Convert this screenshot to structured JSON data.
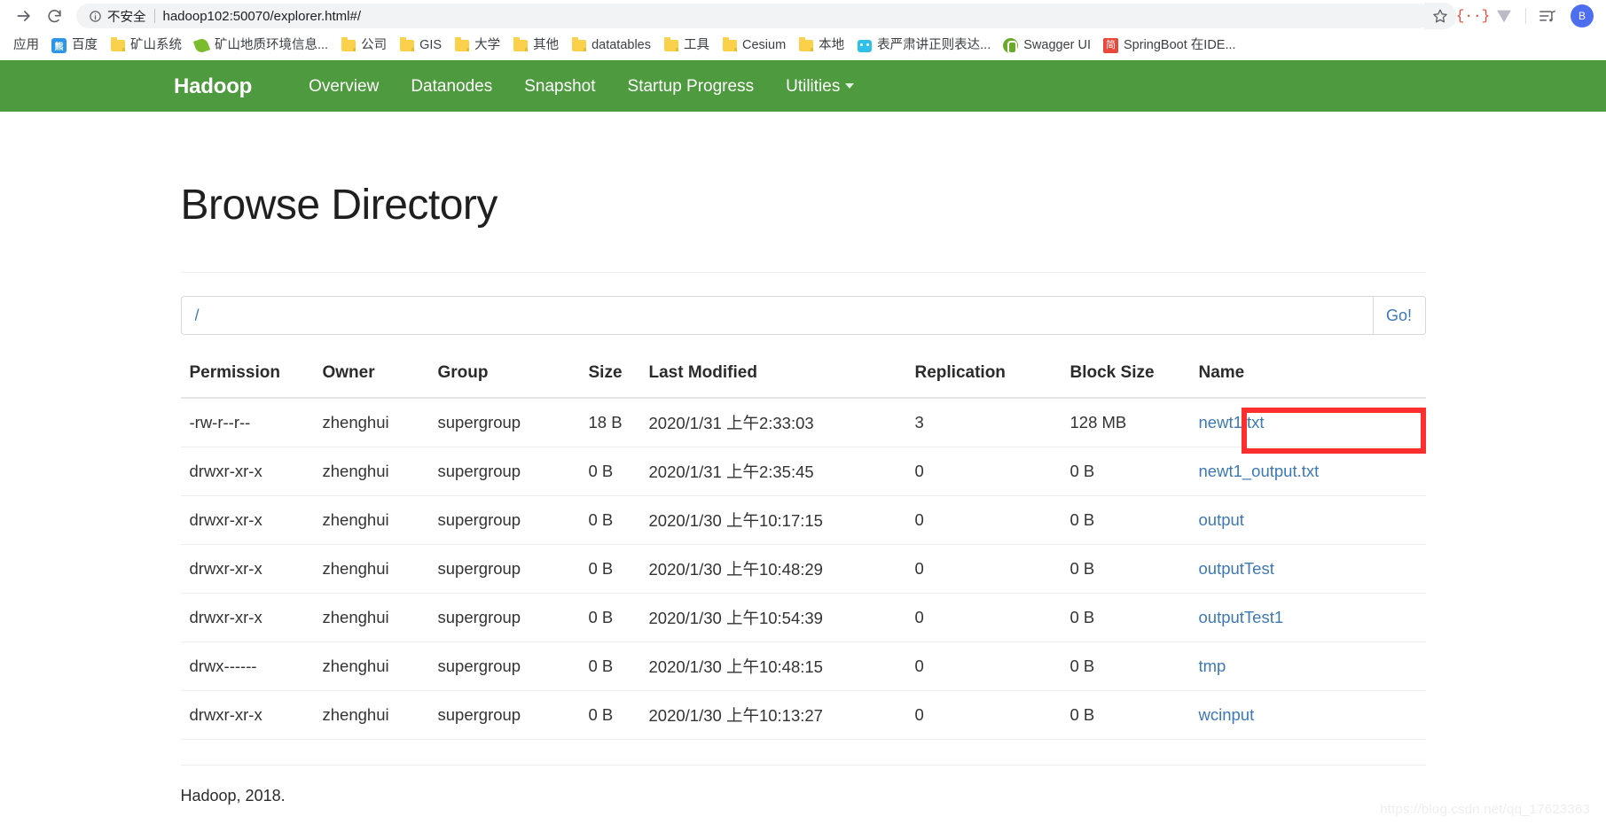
{
  "browser": {
    "back_icon": "back-arrow-icon",
    "reload_icon": "reload-icon",
    "info_icon": "info-circle-icon",
    "security_label": "不安全",
    "url": "hadoop102:50070/explorer.html#/",
    "star_icon": "star-icon",
    "extensions": [
      {
        "name": "json-formatter-icon",
        "glyph": "{ }"
      },
      {
        "name": "vue-devtools-icon",
        "glyph": "V"
      },
      {
        "name": "reading-list-icon",
        "glyph": "≡♪"
      }
    ],
    "avatar_label": "B",
    "bookmarks": [
      {
        "label": "应用",
        "icon": "apps-icon"
      },
      {
        "label": "百度",
        "icon": "baidu-icon"
      },
      {
        "label": "矿山系统",
        "icon": "folder-icon"
      },
      {
        "label": "矿山地质环境信息...",
        "icon": "leaf-icon"
      },
      {
        "label": "公司",
        "icon": "folder-icon"
      },
      {
        "label": "GIS",
        "icon": "folder-icon"
      },
      {
        "label": "大学",
        "icon": "folder-icon"
      },
      {
        "label": "其他",
        "icon": "folder-icon"
      },
      {
        "label": "datatables",
        "icon": "folder-icon"
      },
      {
        "label": "工具",
        "icon": "folder-icon"
      },
      {
        "label": "Cesium",
        "icon": "folder-icon"
      },
      {
        "label": "本地",
        "icon": "folder-icon"
      },
      {
        "label": "表严肃讲正则表达...",
        "icon": "tv-icon"
      },
      {
        "label": "Swagger UI",
        "icon": "swagger-icon"
      },
      {
        "label": "SpringBoot 在IDE...",
        "icon": "jianshu-icon"
      }
    ]
  },
  "navbar": {
    "brand": "Hadoop",
    "background_color": "#4e9a3e",
    "links": [
      {
        "label": "Overview"
      },
      {
        "label": "Datanodes"
      },
      {
        "label": "Snapshot"
      },
      {
        "label": "Startup Progress"
      },
      {
        "label": "Utilities",
        "has_caret": true
      }
    ]
  },
  "main": {
    "title": "Browse Directory",
    "path_value": "/",
    "path_placeholder": "",
    "go_label": "Go!",
    "columns": [
      "Permission",
      "Owner",
      "Group",
      "Size",
      "Last Modified",
      "Replication",
      "Block Size",
      "Name"
    ],
    "rows": [
      {
        "permission": "-rw-r--r--",
        "owner": "zhenghui",
        "group": "supergroup",
        "size": "18 B",
        "last_modified": "2020/1/31 上午2:33:03",
        "replication": "3",
        "block_size": "128 MB",
        "name": "newt1.txt"
      },
      {
        "permission": "drwxr-xr-x",
        "owner": "zhenghui",
        "group": "supergroup",
        "size": "0 B",
        "last_modified": "2020/1/31 上午2:35:45",
        "replication": "0",
        "block_size": "0 B",
        "name": "newt1_output.txt"
      },
      {
        "permission": "drwxr-xr-x",
        "owner": "zhenghui",
        "group": "supergroup",
        "size": "0 B",
        "last_modified": "2020/1/30 上午10:17:15",
        "replication": "0",
        "block_size": "0 B",
        "name": "output"
      },
      {
        "permission": "drwxr-xr-x",
        "owner": "zhenghui",
        "group": "supergroup",
        "size": "0 B",
        "last_modified": "2020/1/30 上午10:48:29",
        "replication": "0",
        "block_size": "0 B",
        "name": "outputTest"
      },
      {
        "permission": "drwxr-xr-x",
        "owner": "zhenghui",
        "group": "supergroup",
        "size": "0 B",
        "last_modified": "2020/1/30 上午10:54:39",
        "replication": "0",
        "block_size": "0 B",
        "name": "outputTest1"
      },
      {
        "permission": "drwx------",
        "owner": "zhenghui",
        "group": "supergroup",
        "size": "0 B",
        "last_modified": "2020/1/30 上午10:48:15",
        "replication": "0",
        "block_size": "0 B",
        "name": "tmp"
      },
      {
        "permission": "drwxr-xr-x",
        "owner": "zhenghui",
        "group": "supergroup",
        "size": "0 B",
        "last_modified": "2020/1/30 上午10:13:27",
        "replication": "0",
        "block_size": "0 B",
        "name": "wcinput"
      }
    ],
    "highlight": {
      "target_name": "newt1_output.txt",
      "color": "#fc2e2e"
    },
    "footer": "Hadoop, 2018."
  },
  "watermark": "https://blog.csdn.net/qq_17623363"
}
